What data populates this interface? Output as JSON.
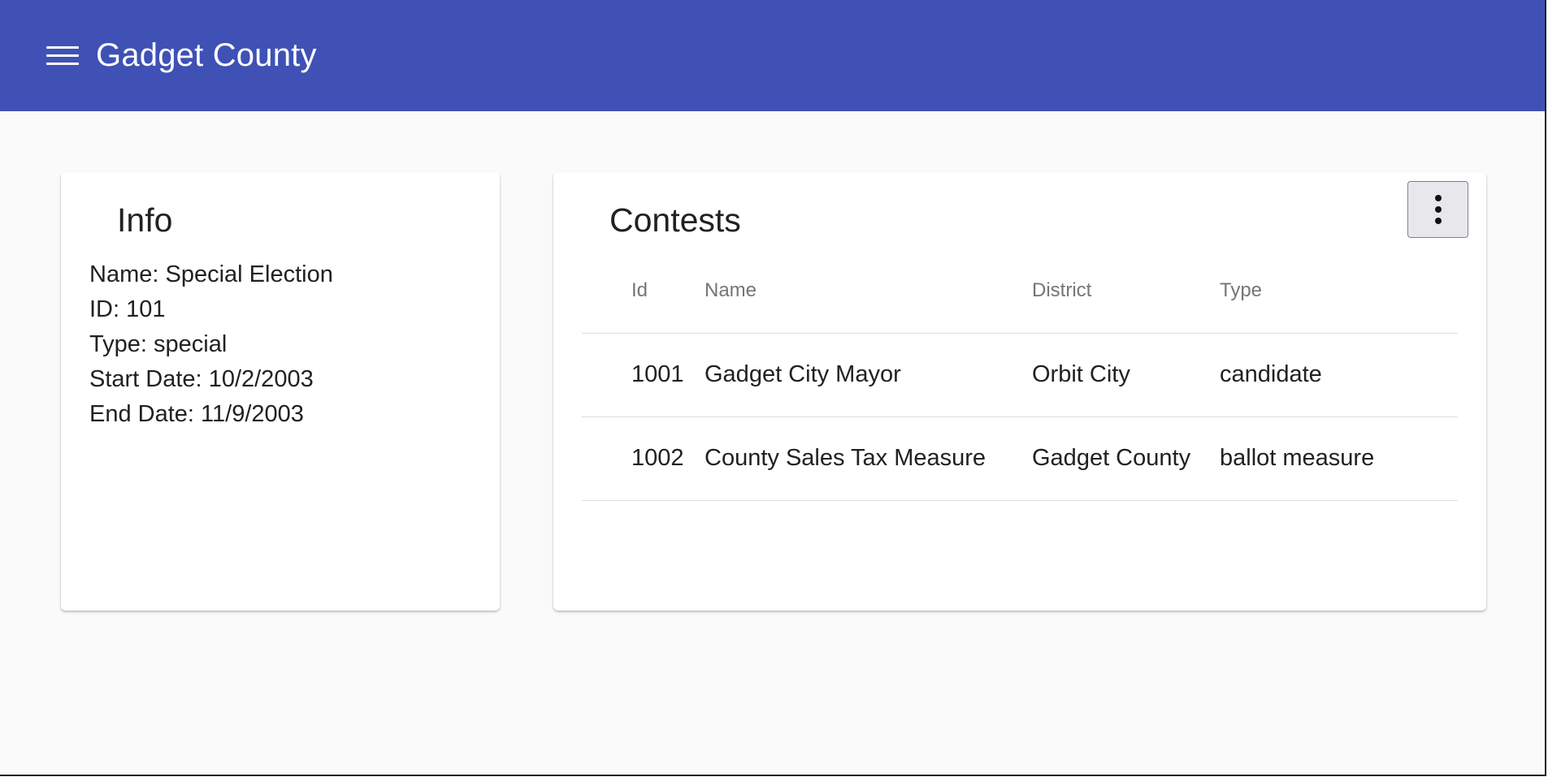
{
  "toolbar": {
    "menu_icon": "hamburger-menu-icon",
    "title": "Gadget County",
    "color": "#3f51b5"
  },
  "info": {
    "title": "Info",
    "rows": [
      {
        "label": "Name:",
        "value": "Special Election"
      },
      {
        "label": "ID:",
        "value": "101"
      },
      {
        "label": "Type:",
        "value": "special"
      },
      {
        "label": "Start Date:",
        "value": "10/2/2003"
      },
      {
        "label": "End Date:",
        "value": "11/9/2003"
      }
    ]
  },
  "contests": {
    "title": "Contests",
    "menu_icon": "more-vert-icon",
    "columns": [
      "Id",
      "Name",
      "District",
      "Type"
    ],
    "rows": [
      {
        "id": "1001",
        "name": "Gadget City Mayor",
        "district": "Orbit City",
        "type": "candidate"
      },
      {
        "id": "1002",
        "name": "County Sales Tax Measure",
        "district": "Gadget County",
        "type": "ballot measure"
      }
    ]
  }
}
